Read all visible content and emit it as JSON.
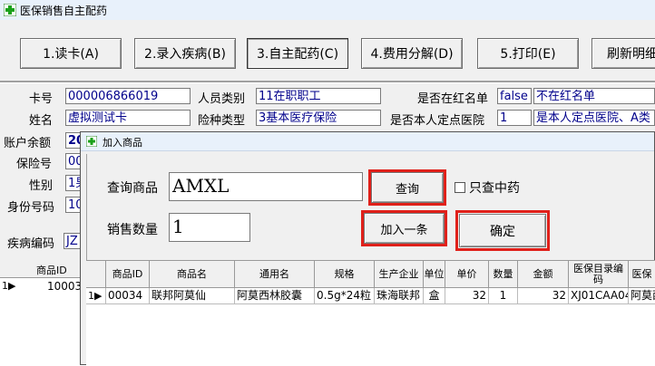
{
  "window": {
    "title": "医保销售自主配药"
  },
  "toolbar": {
    "buttons": [
      "1.读卡(A)",
      "2.录入疾病(B)",
      "3.自主配药(C)",
      "4.费用分解(D)",
      "5.打印(E)",
      "刷新明细"
    ]
  },
  "info": {
    "card_no_label": "卡号",
    "card_no": "000006866019",
    "person_type_label": "人员类别",
    "person_type": "11在职职工",
    "redlist_label": "是否在红名单",
    "redlist_code": "false",
    "redlist_text": "不在红名单",
    "name_label": "姓名",
    "name": "虚拟测试卡",
    "insurance_label": "险种类型",
    "insurance": "3基本医疗保险",
    "designated_label": "是否本人定点医院",
    "designated_code": "1",
    "designated_text": "是本人定点医院、A类",
    "balance_label": "账户余额",
    "balance": "20",
    "insure_no_label": "保险号",
    "insure_no": "00",
    "gender_label": "性别",
    "gender": "1男",
    "id_label": "身份号码",
    "id_no": "10",
    "disease_label": "疾病编码",
    "disease": "JZ",
    "grid_header": "商品ID",
    "grid_row_marker": "1▶",
    "grid_row_id": "10003"
  },
  "dialog": {
    "title": "加入商品",
    "query_label": "查询商品",
    "query_value": "AMXL",
    "query_button": "查询",
    "only_chinese_label": "只查中药",
    "qty_label": "销售数量",
    "qty_value": "1",
    "add_button": "加入一条",
    "confirm_button": "确定",
    "columns": [
      "商品ID",
      "商品名",
      "通用名",
      "规格",
      "生产企业",
      "单位",
      "单价",
      "数量",
      "金额",
      "医保目录编码",
      "医保"
    ],
    "row": {
      "marker": "1▶",
      "id": "00034",
      "name": "联邦阿莫仙",
      "generic": "阿莫西林胶囊",
      "spec": "0.5g*24粒",
      "maker": "珠海联邦",
      "unit": "盒",
      "price": "32",
      "qty": "1",
      "amount": "32",
      "code": "XJ01CAA04",
      "ins": "阿莫西"
    }
  }
}
